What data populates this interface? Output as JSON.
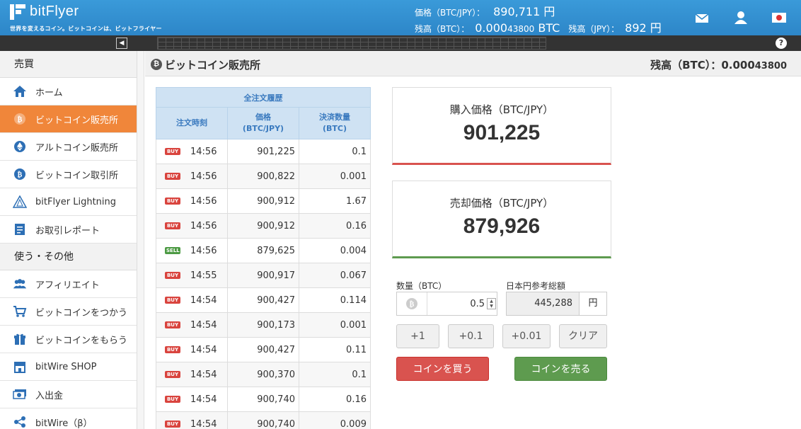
{
  "header": {
    "logo_text": "bitFlyer",
    "tagline": "世界を変えるコイン。ビットコインは、ビットフライヤー",
    "price_label": "価格（BTC/JPY）：",
    "price_value": "890,711 円",
    "btc_balance_label": "残高（BTC）：",
    "btc_balance_main": "0.000",
    "btc_balance_small": "43800",
    "btc_balance_unit": " BTC",
    "jpy_balance_label": "残高（JPY）：",
    "jpy_balance_value": "892 円"
  },
  "sidebar": {
    "section_trade": "売買",
    "section_other": "使う・その他",
    "trade_items": [
      {
        "label": "ホーム",
        "icon": "home-icon"
      },
      {
        "label": "ビットコイン販売所",
        "icon": "bitcoin-icon"
      },
      {
        "label": "アルトコイン販売所",
        "icon": "ethereum-icon"
      },
      {
        "label": "ビットコイン取引所",
        "icon": "bitcoin-icon"
      },
      {
        "label": "bitFlyer Lightning",
        "icon": "lightning-icon"
      },
      {
        "label": "お取引レポート",
        "icon": "report-icon"
      }
    ],
    "other_items": [
      {
        "label": "アフィリエイト",
        "icon": "people-icon"
      },
      {
        "label": "ビットコインをつかう",
        "icon": "cart-icon"
      },
      {
        "label": "ビットコインをもらう",
        "icon": "gift-icon"
      },
      {
        "label": "bitWire SHOP",
        "icon": "shop-icon"
      },
      {
        "label": "入出金",
        "icon": "money-icon"
      },
      {
        "label": "bitWire（β）",
        "icon": "share-icon"
      }
    ]
  },
  "main": {
    "title": "ビットコイン販売所",
    "balance_label": "残高（BTC）：",
    "balance_main": "0.000",
    "balance_small": "43800"
  },
  "orders": {
    "caption": "全注文履歴",
    "col_time": "注文時刻",
    "col_price_1": "価格",
    "col_price_2": "(BTC/JPY)",
    "col_size_1": "決済数量",
    "col_size_2": "(BTC)",
    "rows": [
      {
        "side": "BUY",
        "time": "14:56",
        "price": "901,225",
        "size": "0.1"
      },
      {
        "side": "BUY",
        "time": "14:56",
        "price": "900,822",
        "size": "0.001"
      },
      {
        "side": "BUY",
        "time": "14:56",
        "price": "900,912",
        "size": "1.67"
      },
      {
        "side": "BUY",
        "time": "14:56",
        "price": "900,912",
        "size": "0.16"
      },
      {
        "side": "SELL",
        "time": "14:56",
        "price": "879,625",
        "size": "0.004"
      },
      {
        "side": "BUY",
        "time": "14:55",
        "price": "900,917",
        "size": "0.067"
      },
      {
        "side": "BUY",
        "time": "14:54",
        "price": "900,427",
        "size": "0.114"
      },
      {
        "side": "BUY",
        "time": "14:54",
        "price": "900,173",
        "size": "0.001"
      },
      {
        "side": "BUY",
        "time": "14:54",
        "price": "900,427",
        "size": "0.11"
      },
      {
        "side": "BUY",
        "time": "14:54",
        "price": "900,370",
        "size": "0.1"
      },
      {
        "side": "BUY",
        "time": "14:54",
        "price": "900,740",
        "size": "0.16"
      },
      {
        "side": "BUY",
        "time": "14:54",
        "price": "900,740",
        "size": "0.009"
      }
    ]
  },
  "buy_card": {
    "label": "購入価格（BTC/JPY）",
    "value": "901,225"
  },
  "sell_card": {
    "label": "売却価格（BTC/JPY）",
    "value": "879,926"
  },
  "form": {
    "qty_label": "数量（BTC）",
    "qty_value": "0.5",
    "jpy_label": "日本円参考総額",
    "jpy_value": "445,288",
    "jpy_unit": "円",
    "inc_1": "+1",
    "inc_01": "+0.1",
    "inc_001": "+0.01",
    "clear": "クリア",
    "buy_button": "コインを買う",
    "sell_button": "コインを売る"
  },
  "colors": {
    "header_blue": "#3a9ad9",
    "active_orange": "#f0863a",
    "buy_red": "#d9534f",
    "sell_green": "#5e9b4f"
  }
}
